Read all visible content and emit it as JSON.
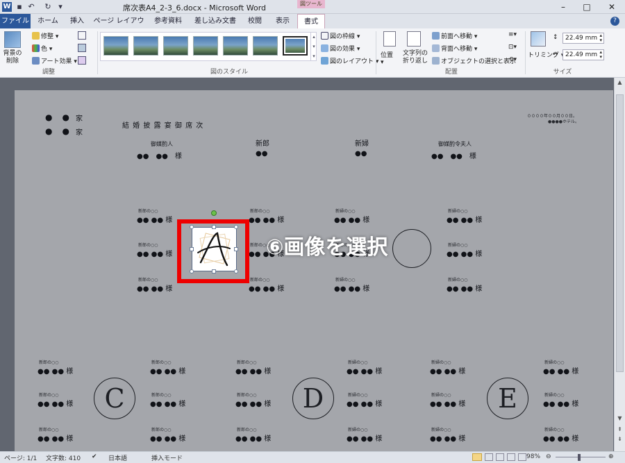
{
  "titlebar": {
    "app_icon": "W",
    "title": "席次表A4_2-3_6.docx - Microsoft Word",
    "context_tool": "図ツール",
    "minimize": "–",
    "maximize": "□",
    "close": "✕"
  },
  "tabs": [
    "ファイル",
    "ホーム",
    "挿入",
    "ページ レイアウト",
    "参考資料",
    "差し込み文書",
    "校閲",
    "表示",
    "書式"
  ],
  "active_tab": "書式",
  "ribbon": {
    "remove_bg": "背景の削除",
    "adjust": {
      "items": [
        "修整",
        "色",
        "アート効果"
      ],
      "label": "調整"
    },
    "styles": {
      "label": "図のスタイル",
      "options": [
        "図の枠線",
        "図の効果",
        "図のレイアウト"
      ]
    },
    "arrange": {
      "label": "配置",
      "position": "位置",
      "wrap": "文字列の折り返し",
      "items": [
        "前面へ移動",
        "背面へ移動",
        "オブジェクトの選択と表示"
      ]
    },
    "size": {
      "label": "サイズ",
      "trim": "トリミング",
      "height": "22.49 mm",
      "width": "22.49 mm"
    }
  },
  "document": {
    "family": {
      "dots": "●　●",
      "suffix": "家"
    },
    "heading": "結 婚 披 露 宴 御 席 次",
    "date": "００００年００月００日。",
    "venue": "●●●●ホテル。",
    "head_table": [
      {
        "role": "御媒酌人",
        "name": "●●　●●　様"
      },
      {
        "role": "新郎",
        "name": "●●"
      },
      {
        "role": "新婦",
        "name": "●●"
      },
      {
        "role": "御媒酌令夫人",
        "name": "●●　●●　様"
      }
    ],
    "guest": {
      "relation_groom": "新郎の○○",
      "relation_bride": "新婦の○○",
      "name": "●● ●● 様"
    },
    "tables": [
      "C",
      "D",
      "E"
    ]
  },
  "annotation": "⑥画像を選択",
  "statusbar": {
    "page": "ページ: 1/1",
    "words": "文字数: 410",
    "lang": "日本語",
    "mode": "挿入モード",
    "zoom": "98%"
  }
}
